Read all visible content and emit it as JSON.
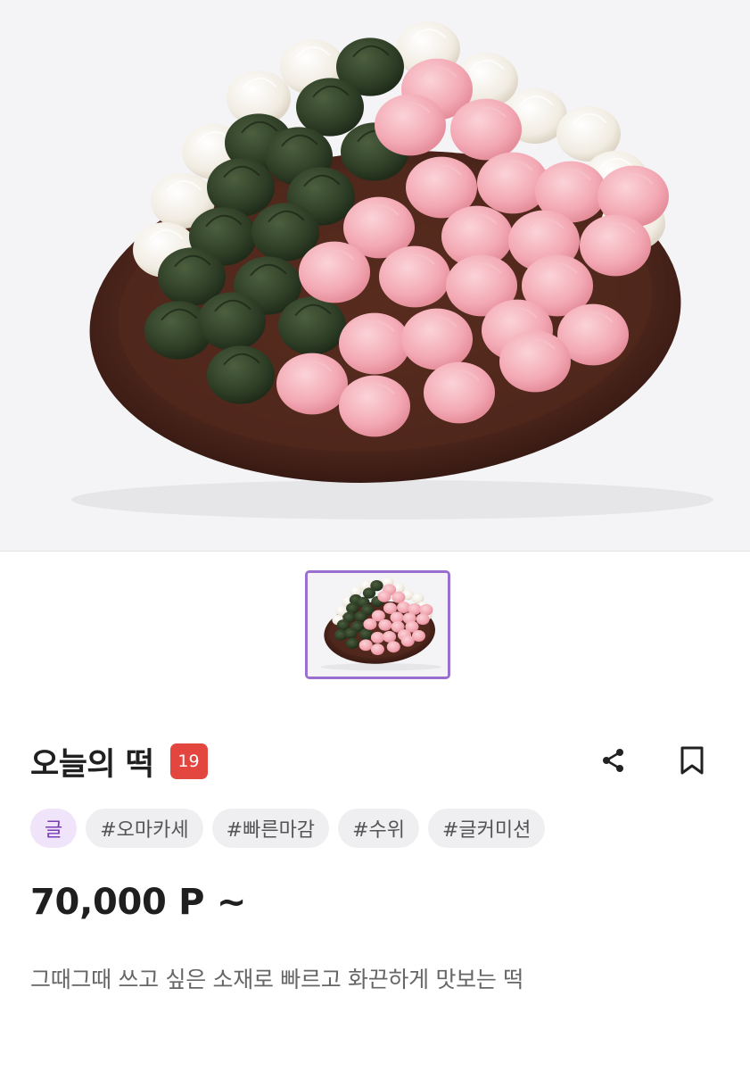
{
  "product": {
    "title": "오늘의 떡",
    "age_rating": "19",
    "price": "70,000 P ~",
    "description": "그때그때 쓰고 싶은 소재로 빠르고 화끈하게 맛보는 떡"
  },
  "tags": {
    "category": "글",
    "hashtags": [
      "#오마카세",
      "#빠른마감",
      "#수위",
      "#글커미션"
    ]
  },
  "actions": {
    "share_icon": "share-icon",
    "bookmark_icon": "bookmark-icon"
  },
  "colors": {
    "accent": "#9b6fd0",
    "badge": "#e2463f",
    "category_tag_bg": "#efe4fa",
    "category_tag_text": "#7a3db5"
  }
}
